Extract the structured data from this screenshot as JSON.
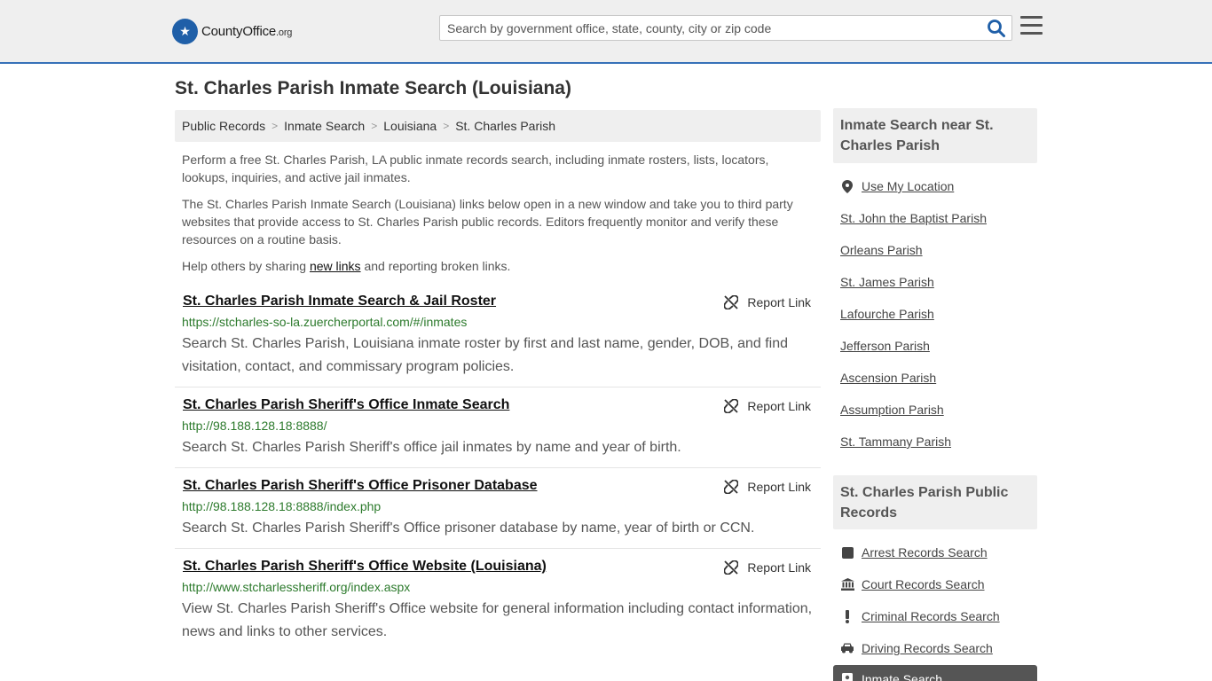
{
  "header": {
    "logo_text_main": "CountyOffice",
    "logo_text_tld": ".org",
    "search_placeholder": "Search by government office, state, county, city or zip code"
  },
  "page_title": "St. Charles Parish Inmate Search (Louisiana)",
  "breadcrumb": [
    "Public Records",
    "Inmate Search",
    "Louisiana",
    "St. Charles Parish"
  ],
  "intro": {
    "p1": "Perform a free St. Charles Parish, LA public inmate records search, including inmate rosters, lists, locators, lookups, inquiries, and active jail inmates.",
    "p2": "The St. Charles Parish Inmate Search (Louisiana) links below open in a new window and take you to third party websites that provide access to St. Charles Parish public records. Editors frequently monitor and verify these resources on a routine basis.",
    "p3_before": "Help others by sharing ",
    "p3_link": "new links",
    "p3_after": " and reporting broken links."
  },
  "report_label": "Report Link",
  "listings": [
    {
      "title": "St. Charles Parish Inmate Search & Jail Roster",
      "url": "https://stcharles-so-la.zuercherportal.com/#/inmates",
      "desc": "Search St. Charles Parish, Louisiana inmate roster by first and last name, gender, DOB, and find visitation, contact, and commissary program policies."
    },
    {
      "title": "St. Charles Parish Sheriff's Office Inmate Search",
      "url": "http://98.188.128.18:8888/",
      "desc": "Search St. Charles Parish Sheriff's office jail inmates by name and year of birth."
    },
    {
      "title": "St. Charles Parish Sheriff's Office Prisoner Database",
      "url": "http://98.188.128.18:8888/index.php",
      "desc": "Search St. Charles Parish Sheriff's Office prisoner database by name, year of birth or CCN."
    },
    {
      "title": "St. Charles Parish Sheriff's Office Website (Louisiana)",
      "url": "http://www.stcharlessheriff.org/index.aspx",
      "desc": "View St. Charles Parish Sheriff's Office website for general information including contact information, news and links to other services."
    }
  ],
  "sidebar": {
    "nearby_heading": "Inmate Search near St. Charles Parish",
    "use_location": "Use My Location",
    "nearby": [
      "St. John the Baptist Parish",
      "Orleans Parish",
      "St. James Parish",
      "Lafourche Parish",
      "Jefferson Parish",
      "Ascension Parish",
      "Assumption Parish",
      "St. Tammany Parish"
    ],
    "records_heading": "St. Charles Parish Public Records",
    "records": [
      {
        "label": "Arrest Records Search",
        "icon": "square-icon"
      },
      {
        "label": "Court Records Search",
        "icon": "courthouse-icon"
      },
      {
        "label": "Criminal Records Search",
        "icon": "exclamation-icon"
      },
      {
        "label": "Driving Records Search",
        "icon": "car-icon"
      }
    ],
    "active_record": "Inmate Search"
  }
}
